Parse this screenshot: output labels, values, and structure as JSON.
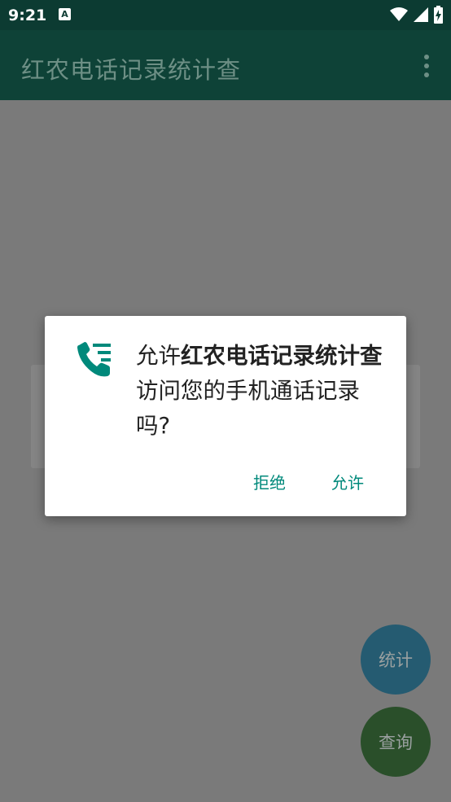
{
  "status_bar": {
    "time": "9:21",
    "notification_letter": "A",
    "icons": [
      "wifi-icon",
      "cell-signal-icon",
      "battery-charging-icon"
    ]
  },
  "app_bar": {
    "title": "红农电话记录统计查",
    "menu_icon": "overflow-menu-icon"
  },
  "dialog": {
    "icon": "call-log-icon",
    "message_prefix": "允许",
    "message_app": "红农电话记录统计查",
    "message_suffix": "访问您的手机通话记录吗?",
    "deny_label": "拒绝",
    "allow_label": "允许",
    "accent_color": "#00897b"
  },
  "fabs": {
    "stats_label": "统计",
    "query_label": "查询"
  }
}
